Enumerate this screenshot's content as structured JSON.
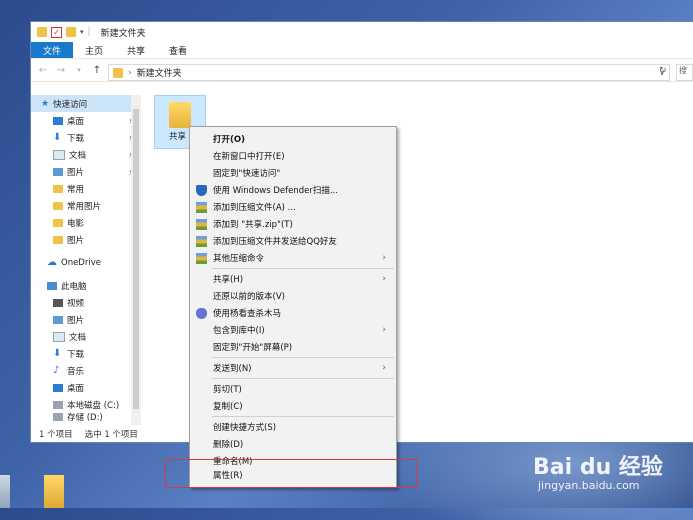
{
  "window": {
    "title": "新建文件夹",
    "tabs": [
      "文件",
      "主页",
      "共享",
      "查看"
    ]
  },
  "address": {
    "path_sep": "›",
    "path": "新建文件夹",
    "search_placeholder": "搜"
  },
  "sidebar": {
    "items": [
      {
        "label": "快速访问",
        "icon": "star-icon",
        "selected": true
      },
      {
        "label": "桌面",
        "icon": "desktop-icon",
        "pinned": true
      },
      {
        "label": "下载",
        "icon": "download-icon",
        "pinned": true
      },
      {
        "label": "文档",
        "icon": "document-icon",
        "pinned": true
      },
      {
        "label": "图片",
        "icon": "pictures-icon",
        "pinned": true
      },
      {
        "label": "常用",
        "icon": "folder-icon"
      },
      {
        "label": "常用图片",
        "icon": "folder-icon"
      },
      {
        "label": "电影",
        "icon": "folder-icon"
      },
      {
        "label": "图片",
        "icon": "folder-icon"
      },
      {
        "label": "OneDrive",
        "icon": "cloud-icon"
      },
      {
        "label": "此电脑",
        "icon": "computer-icon"
      },
      {
        "label": "视频",
        "icon": "video-icon"
      },
      {
        "label": "图片",
        "icon": "pictures-icon"
      },
      {
        "label": "文档",
        "icon": "document-icon"
      },
      {
        "label": "下载",
        "icon": "download-icon"
      },
      {
        "label": "音乐",
        "icon": "music-icon"
      },
      {
        "label": "桌面",
        "icon": "desktop-icon"
      },
      {
        "label": "本地磁盘 (C:)",
        "icon": "drive-icon"
      },
      {
        "label": "存储 (D:)",
        "icon": "drive-icon"
      }
    ]
  },
  "content": {
    "items": [
      {
        "label": "共享",
        "icon": "folder-icon",
        "selected": true
      }
    ]
  },
  "status": {
    "count": "1 个项目",
    "selected": "选中 1 个项目"
  },
  "context_menu": {
    "items": [
      {
        "label": "打开(O)",
        "bold": true
      },
      {
        "label": "在新窗口中打开(E)"
      },
      {
        "label": "固定到\"快速访问\""
      },
      {
        "label": "使用 Windows Defender扫描...",
        "icon": "defender-icon"
      },
      {
        "label": "添加到压缩文件(A) ...",
        "icon": "winrar-icon"
      },
      {
        "label": "添加到 \"共享.zip\"(T)",
        "icon": "winrar-icon"
      },
      {
        "label": "添加到压缩文件并发送给QQ好友",
        "icon": "winrar-icon"
      },
      {
        "label": "其他压缩命令",
        "icon": "winrar-icon",
        "submenu": true
      },
      {
        "label": "共享(H)",
        "submenu": true
      },
      {
        "label": "还原以前的版本(V)"
      },
      {
        "label": "使用杨看查杀木马",
        "icon": "antivirus-icon"
      },
      {
        "label": "包含到库中(I)",
        "submenu": true
      },
      {
        "label": "固定到\"开始\"屏幕(P)"
      },
      {
        "label": "发送到(N)",
        "submenu": true
      },
      {
        "label": "剪切(T)"
      },
      {
        "label": "复制(C)"
      },
      {
        "label": "创建快捷方式(S)"
      },
      {
        "label": "删除(D)"
      },
      {
        "label": "重命名(M)"
      },
      {
        "label": "属性(R)"
      }
    ]
  },
  "watermark": {
    "main": "Bai du 经验",
    "sub": "jingyan.baidu.com"
  },
  "colors": {
    "accent": "#1979ca",
    "highlight_box": "#d63b3b"
  }
}
